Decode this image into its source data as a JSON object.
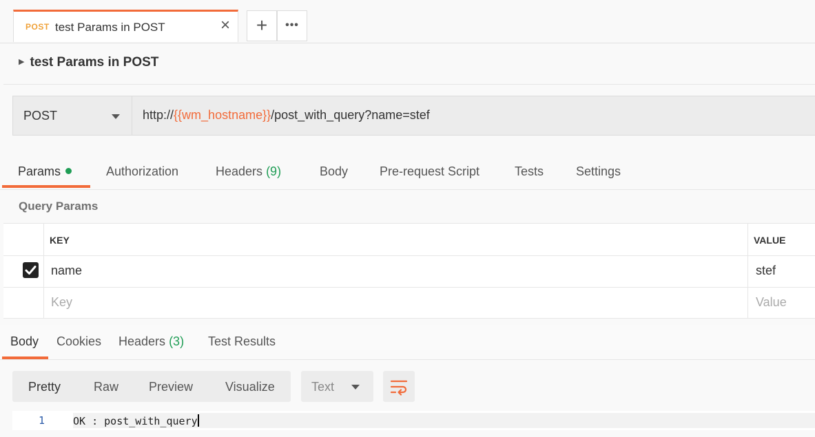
{
  "request_tab": {
    "method": "POST",
    "title": "test Params in POST",
    "close_label": "×",
    "add_label": "+",
    "more_label": "•••"
  },
  "request_name": "test Params in POST",
  "url_bar": {
    "method": "POST",
    "url_prefix": "http://",
    "url_variable": "{{wm_hostname}}",
    "url_suffix": "/post_with_query?name=stef"
  },
  "request_tabs": {
    "params": "Params",
    "authorization": "Authorization",
    "headers": "Headers",
    "headers_count": "(9)",
    "body": "Body",
    "prerequest": "Pre-request Script",
    "tests": "Tests",
    "settings": "Settings"
  },
  "query_params": {
    "title": "Query Params",
    "key_header": "KEY",
    "value_header": "VALUE",
    "rows": [
      {
        "key": "name",
        "value": "stef",
        "checked": true
      }
    ],
    "key_placeholder": "Key",
    "value_placeholder": "Value"
  },
  "response_tabs": {
    "body": "Body",
    "cookies": "Cookies",
    "headers": "Headers",
    "headers_count": "(3)",
    "test_results": "Test Results"
  },
  "response_toolbar": {
    "pretty": "Pretty",
    "raw": "Raw",
    "preview": "Preview",
    "visualize": "Visualize",
    "format": "Text"
  },
  "response_body": {
    "line_number": "1",
    "text": "OK : post_with_query"
  },
  "colors": {
    "accent": "#f26b3a",
    "method_post": "#f0a23a",
    "count_green": "#1f9d55"
  }
}
